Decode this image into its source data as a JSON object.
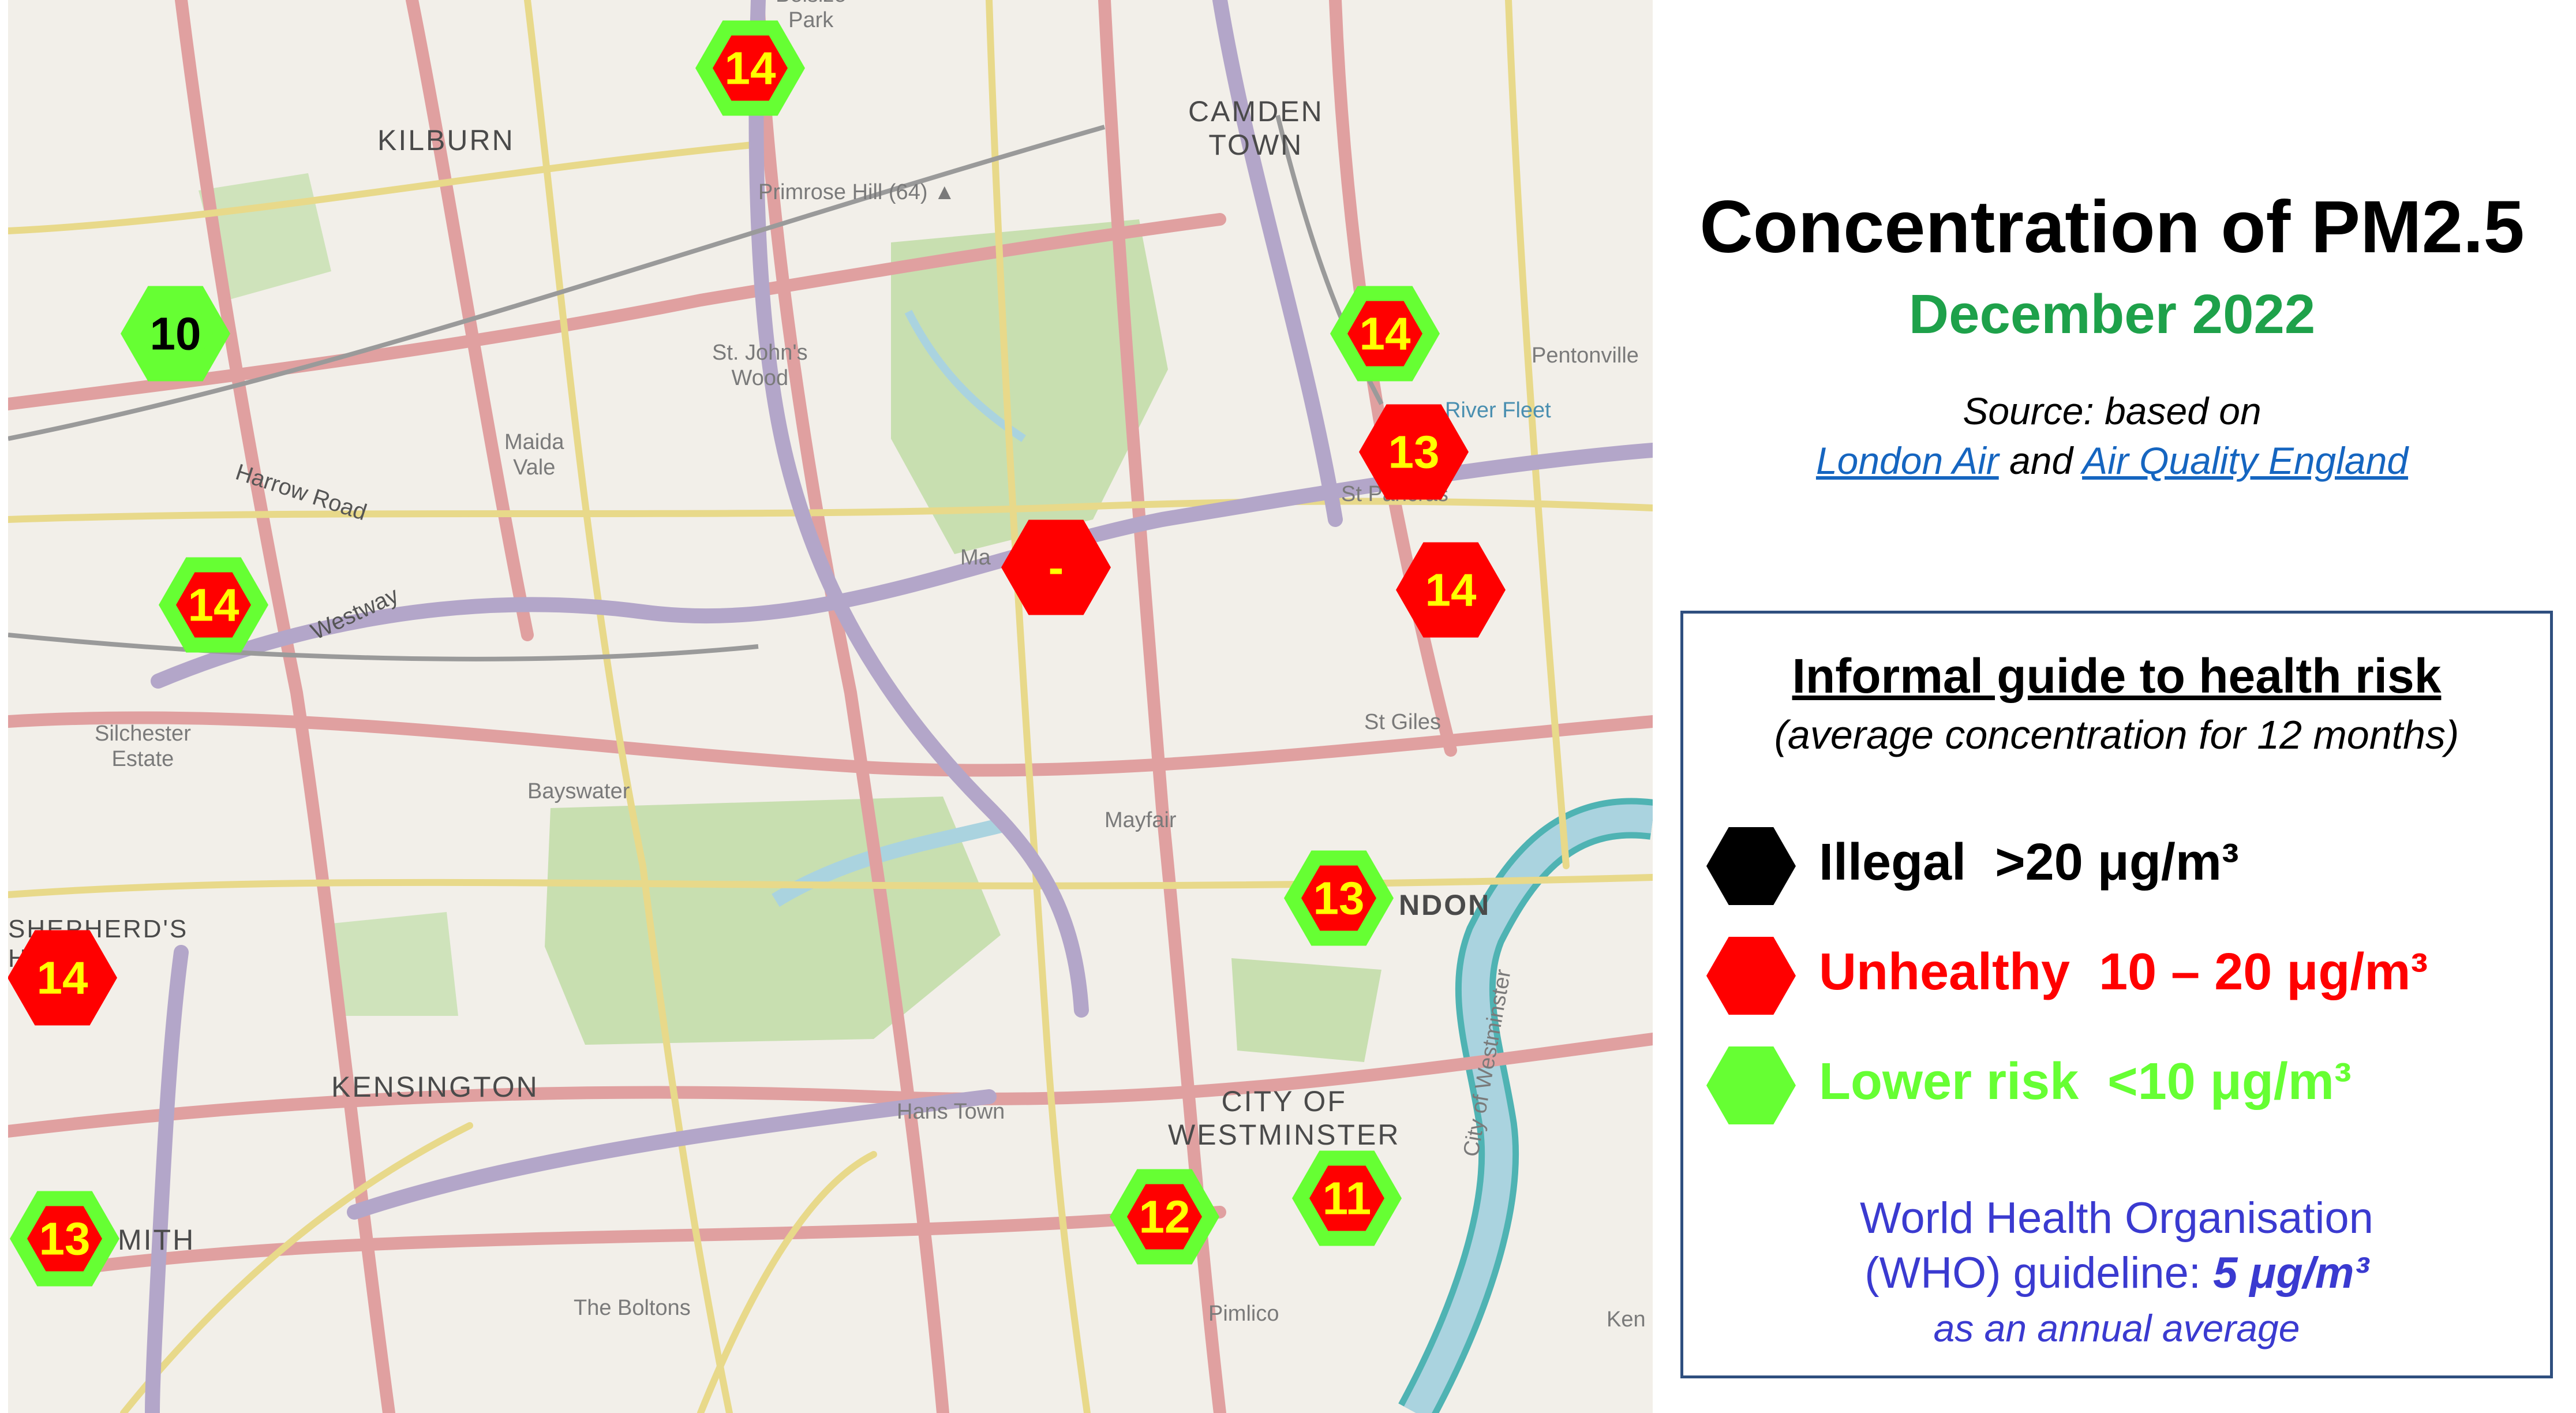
{
  "map": {
    "places": {
      "belsize_park": "Belsize\nPark",
      "kilburn": "KILBURN",
      "camden_town": "CAMDEN\nTOWN",
      "primrose_hill": "Primrose Hill (64) ▲",
      "st_johns_wood": "St. John's\nWood",
      "pentonville": "Pentonville",
      "river_fleet": "River Fleet",
      "maida_vale": "Maida\nVale",
      "harrow_road": "Harrow Road",
      "st_pancras": "St Pancras",
      "westway": "Westway",
      "marylebone": "Ma",
      "silchester_estate": "Silchester\nEstate",
      "st_giles": "St Giles",
      "bayswater": "Bayswater",
      "mayfair": "Mayfair",
      "london": "NDON",
      "shepherds_bush": "SHEPHERD'S\nH",
      "city_of_westminster_road": "City of Westminster",
      "kensington": "KENSINGTON",
      "hans_town": "Hans Town",
      "city_of_westminster": "CITY OF\nWESTMINSTER",
      "hammersmith": "MITH",
      "the_boltons": "The Boltons",
      "pimlico": "Pimlico",
      "kennington": "Ken"
    },
    "markers": [
      {
        "value": "14",
        "outer": "#66ff33",
        "inner": "#ff0000",
        "text": "#ffff00"
      },
      {
        "value": "10",
        "outer": "#66ff33",
        "inner": "#66ff33",
        "text": "#000000"
      },
      {
        "value": "14",
        "outer": "#66ff33",
        "inner": "#ff0000",
        "text": "#ffff00"
      },
      {
        "value": "13",
        "outer": "#ff0000",
        "inner": "#ff0000",
        "text": "#ffff00"
      },
      {
        "value": "-",
        "outer": "#ff0000",
        "inner": "#ff0000",
        "text": "#ffff00"
      },
      {
        "value": "14",
        "outer": "#ff0000",
        "inner": "#ff0000",
        "text": "#ffff00"
      },
      {
        "value": "14",
        "outer": "#66ff33",
        "inner": "#ff0000",
        "text": "#ffff00"
      },
      {
        "value": "13",
        "outer": "#66ff33",
        "inner": "#ff0000",
        "text": "#ffff00"
      },
      {
        "value": "14",
        "outer": "#ff0000",
        "inner": "#ff0000",
        "text": "#ffff00"
      },
      {
        "value": "12",
        "outer": "#66ff33",
        "inner": "#ff0000",
        "text": "#ffff00"
      },
      {
        "value": "11",
        "outer": "#66ff33",
        "inner": "#ff0000",
        "text": "#ffff00"
      },
      {
        "value": "13",
        "outer": "#66ff33",
        "inner": "#ff0000",
        "text": "#ffff00"
      }
    ]
  },
  "panel": {
    "title": "Concentration of PM2.5",
    "subtitle": "December 2022",
    "source_prefix": "Source: based on",
    "source_link1": "London Air",
    "source_and": " and ",
    "source_link2": "Air Quality England",
    "guide_title": "Informal guide to health risk",
    "guide_subtitle": "(average concentration for 12 months)",
    "legend": [
      {
        "label": "Illegal  >20 μg/m³",
        "color": "#000000"
      },
      {
        "label": "Unhealthy  10 – 20 μg/m³",
        "color": "#ff0000"
      },
      {
        "label": "Lower risk  <10 μg/m³",
        "color": "#66ff33"
      }
    ],
    "who_line1": "World Health Organisation",
    "who_line2_prefix": "(WHO) guideline: ",
    "who_value": "5 μg/m³",
    "who_note": "as an annual average"
  }
}
